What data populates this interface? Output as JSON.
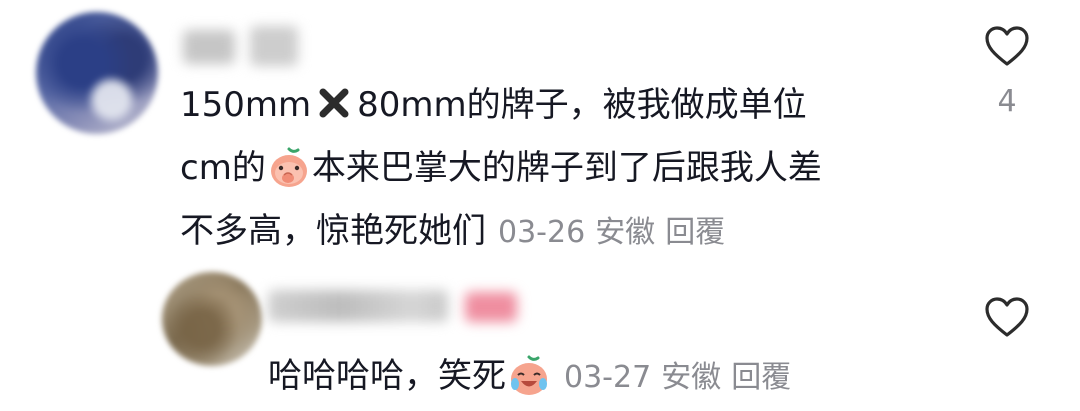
{
  "comments": [
    {
      "lines": [
        "150mm",
        "80mm的牌子，被我做成单位",
        "cm的",
        "本来巴掌大的牌子到了后跟我人差",
        "不多高，惊艳死她们"
      ],
      "date": "03-26",
      "location": "安徽",
      "reply_label": "回覆",
      "like_count": "4",
      "icons": {
        "avatar": "avatar",
        "inline": [
          "cross-mark-icon",
          "covering-mouth-emoji"
        ],
        "like": "heart-icon"
      }
    },
    {
      "text": "哈哈哈哈，笑死",
      "date": "03-27",
      "location": "安徽",
      "reply_label": "回覆",
      "icons": {
        "avatar": "avatar",
        "inline": [
          "crying-laughing-emoji"
        ],
        "like": "heart-icon"
      }
    }
  ],
  "colors": {
    "text": "#161823",
    "meta": "#8a8b91",
    "emoji": "#f4a08a",
    "icon": "#2c2c2c"
  }
}
